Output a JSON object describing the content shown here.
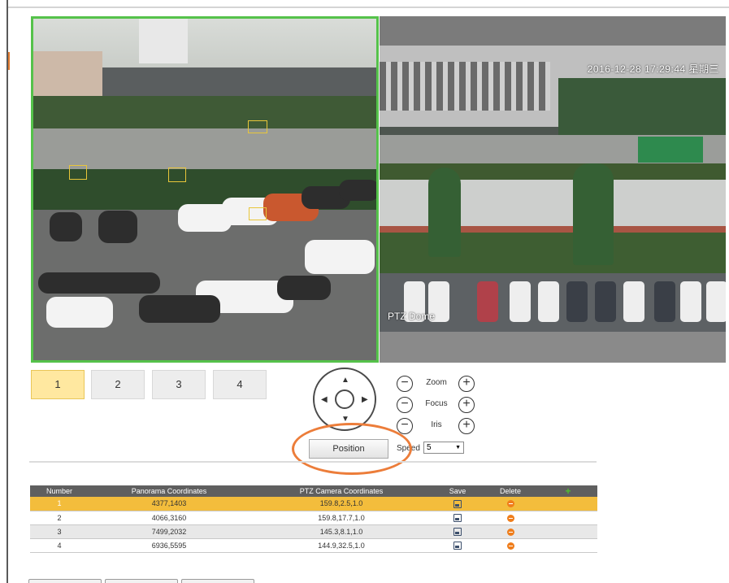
{
  "video": {
    "osd_time": "2016-12-28 17:29:44 星期三",
    "osd_label": "PTZ Dome",
    "selected_pane_color": "#55c24a"
  },
  "presets": {
    "tabs": [
      "1",
      "2",
      "3",
      "4"
    ],
    "active": "1"
  },
  "ptz": {
    "zoom_label": "Zoom",
    "focus_label": "Focus",
    "iris_label": "Iris",
    "minus_symbol": "−",
    "plus_symbol": "+",
    "position_label": "Position",
    "speed_label": "Speed",
    "speed_value": "5",
    "arrow_up": "▲",
    "arrow_down": "▼",
    "arrow_left": "◀",
    "arrow_right": "▶"
  },
  "table": {
    "headers": {
      "number": "Number",
      "panorama": "Panorama Coordinates",
      "ptz": "PTZ Camera Coordinates",
      "save": "Save",
      "delete": "Delete",
      "add": "+"
    },
    "rows": [
      {
        "number": "1",
        "panorama": "4377,1403",
        "ptz": "159.8,2.5,1.0"
      },
      {
        "number": "2",
        "panorama": "4066,3160",
        "ptz": "159.8,17.7,1.0"
      },
      {
        "number": "3",
        "panorama": "7499,2032",
        "ptz": "145.3,8.1,1.0"
      },
      {
        "number": "4",
        "panorama": "6936,5595",
        "ptz": "144.9,32.5,1.0"
      }
    ]
  },
  "colors": {
    "selected_row": "#f3bd3c",
    "active_tab": "#ffe8a0",
    "annotation": "#ec7d3a",
    "delete_icon": "#ef7d1b",
    "add_icon": "#4fbf2f"
  }
}
